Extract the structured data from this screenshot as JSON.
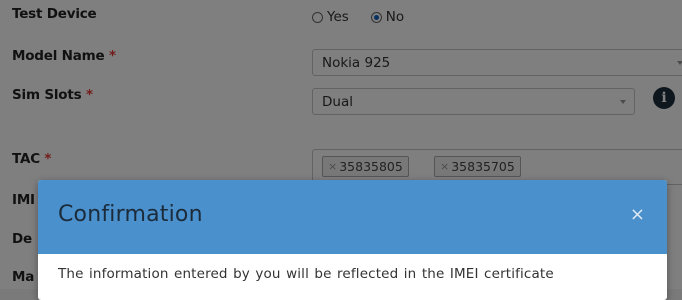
{
  "form": {
    "test_device": {
      "label": "Test Device",
      "options": [
        "Yes",
        "No"
      ],
      "selected": "No"
    },
    "model_name": {
      "label": "Model Name",
      "required_mark": "*",
      "value": "Nokia 925"
    },
    "sim_slots": {
      "label": "Sim Slots",
      "required_mark": "*",
      "value": "Dual"
    },
    "tac": {
      "label": "TAC",
      "required_mark": "*",
      "tags": [
        "35835805",
        "35835705"
      ],
      "remove_glyph": "×"
    },
    "hidden_labels": [
      "IMI",
      "De",
      "Ma"
    ]
  },
  "modal": {
    "title": "Confirmation",
    "close_glyph": "×",
    "body": "The information entered by you will be reflected in the IMEI certificate"
  },
  "icons": {
    "info": "info-icon",
    "caret": "chevron-down-icon",
    "close": "close-icon"
  },
  "colors": {
    "modal_header": "#4a90cc",
    "required": "#e53935",
    "info_icon": "#1f2e3c"
  }
}
